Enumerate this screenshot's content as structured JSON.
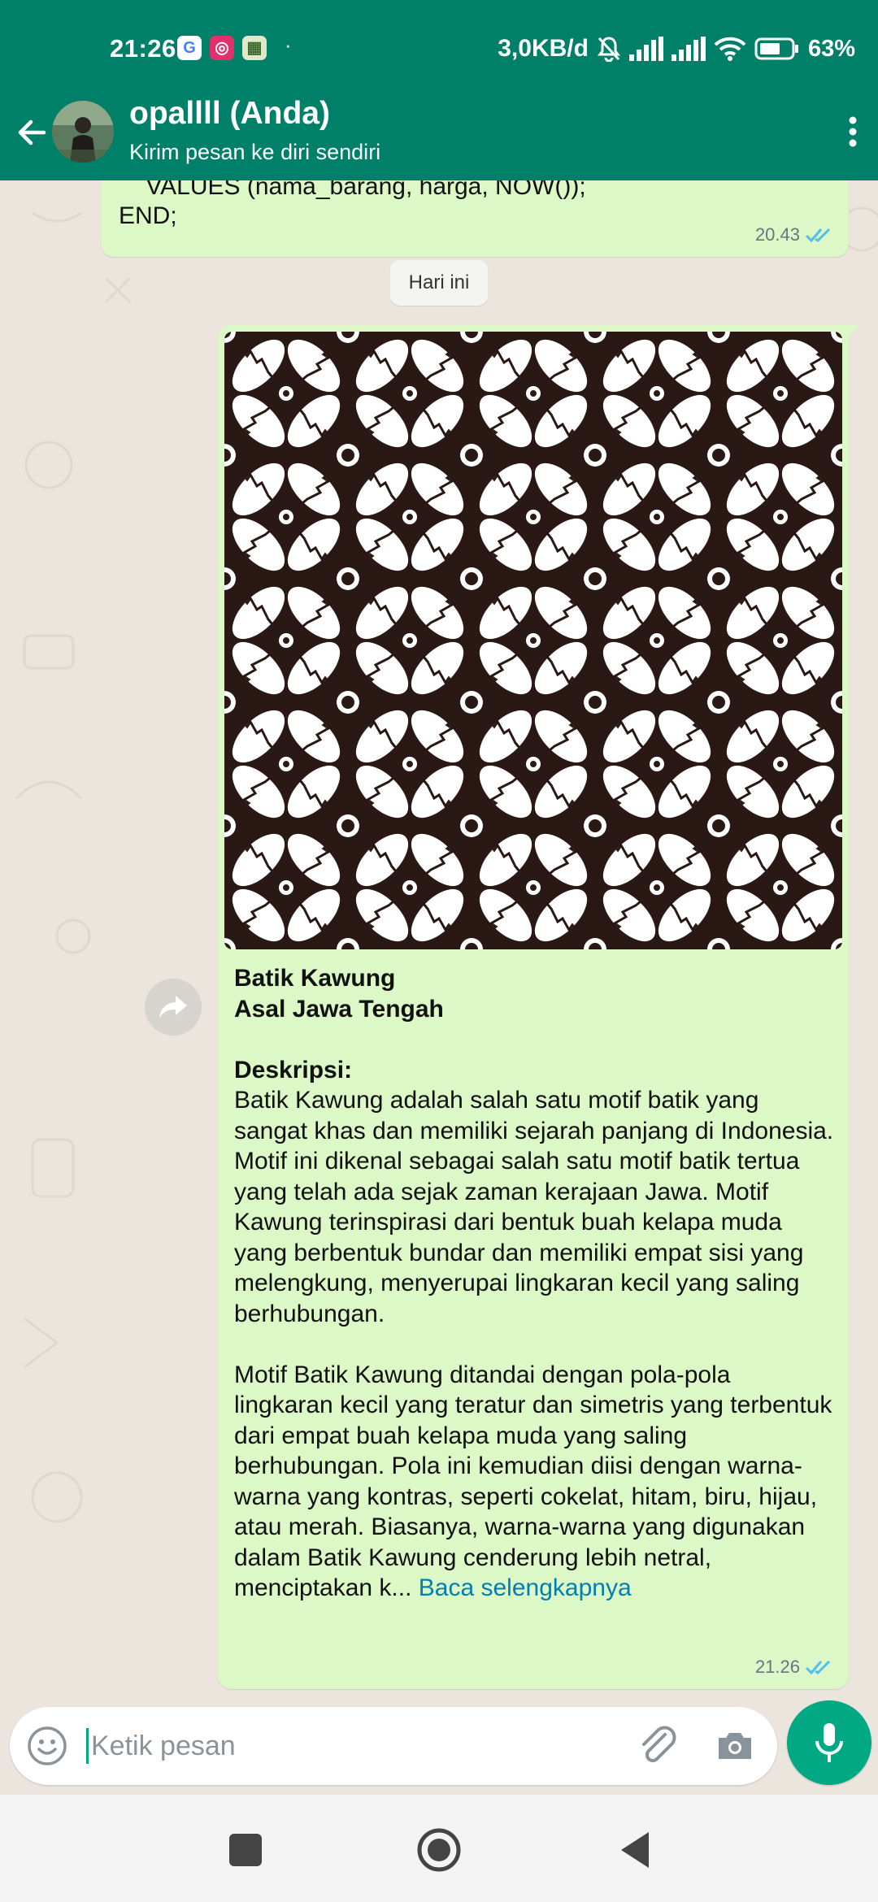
{
  "status_bar": {
    "time": "21:26",
    "network_speed": "3,0KB/d",
    "battery": "63%",
    "app_icons": [
      "google-icon",
      "instagram-icon",
      "gallery-app-icon"
    ]
  },
  "header": {
    "title": "opallll (Anda)",
    "subtitle": "Kirim pesan ke diri sendiri"
  },
  "previous_message": {
    "code_lines": [
      "    VALUES (nama_barang, harga, NOW());",
      "END;"
    ],
    "time": "20.43"
  },
  "date_divider": "Hari ini",
  "message": {
    "line1": "Batik Kawung",
    "line2": "Asal Jawa Tengah",
    "desc_label": "Deskripsi:",
    "para1": "Batik Kawung adalah salah satu motif batik yang sangat khas dan memiliki sejarah panjang di Indonesia. Motif ini dikenal sebagai salah satu motif batik tertua yang telah ada sejak zaman kerajaan Jawa. Motif Kawung terinspirasi dari bentuk buah kelapa muda yang berbentuk bundar dan memiliki empat sisi yang melengkung, menyerupai lingkaran kecil yang saling berhubungan.",
    "para2": "Motif Batik Kawung ditandai dengan pola-pola lingkaran kecil yang teratur dan simetris yang terbentuk dari empat buah kelapa muda yang saling berhubungan. Pola ini kemudian diisi dengan warna-warna yang kontras, seperti cokelat, hitam, biru, hijau, atau merah. Biasanya, warna-warna yang digunakan dalam Batik Kawung cenderung lebih netral, menciptakan k...",
    "read_more": "Baca selengkapnya",
    "time": "21.26"
  },
  "composer": {
    "placeholder": "Ketik pesan"
  },
  "colors": {
    "header": "#008069",
    "bubble": "#dcf8c6",
    "background": "#ece5dd",
    "read_ticks": "#53bdeb",
    "mic_button": "#00a884",
    "link": "#027eb5",
    "batik_dark": "#2a1814"
  }
}
